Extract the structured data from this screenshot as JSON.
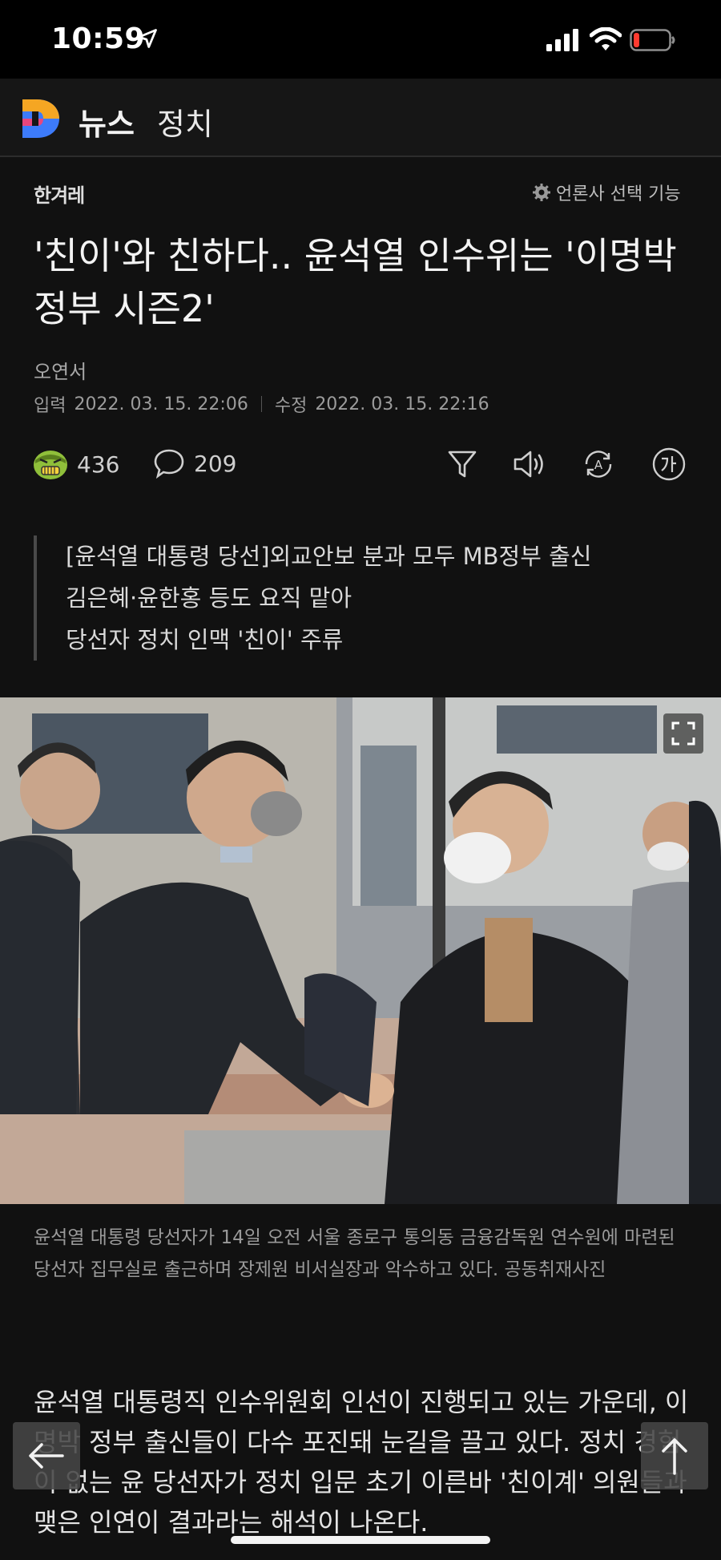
{
  "status_bar": {
    "time": "10:59"
  },
  "header": {
    "news": "뉴스",
    "section": "정치"
  },
  "article": {
    "press": "한겨레",
    "press_select": "언론사 선택 기능",
    "title": "'친이'와 친하다.. 윤석열 인수위는 '이명박정부 시즌2'",
    "author": "오연서",
    "input_label": "입력",
    "input_date": "2022. 03. 15. 22:06",
    "edit_label": "수정",
    "edit_date": "2022. 03. 15. 22:16",
    "reaction_count": "436",
    "comment_count": "209",
    "summary": [
      "[윤석열 대통령 당선]외교안보 분과 모두 MB정부 출신",
      "김은혜·윤한홍 등도 요직 맡아",
      "당선자 정치 인맥 '친이' 주류"
    ],
    "caption": "윤석열 대통령 당선자가 14일 오전 서울 종로구 통의동 금융감독원 연수원에 마련된 당선자 집무실로 출근하며 장제원 비서실장과 악수하고 있다. 공동취재사진",
    "body": "윤석열 대통령직 인수위원회 인선이 진행되고 있는 가운데, 이명박 정부 출신들이 다수 포진돼 눈길을 끌고 있다. 정치 경험이 없는 윤 당선자가 정치 입문 초기 이른바 '친이계' 의원들과 맺은 인연이 결과라는 해석이 나온다."
  },
  "icons": {
    "status": [
      "location-arrow-icon",
      "signal-icon",
      "wifi-icon",
      "battery-low-icon"
    ],
    "toolbar": [
      "filter-icon",
      "speaker-icon",
      "translate-icon",
      "font-size-icon"
    ],
    "nav": [
      "back-arrow-icon",
      "scroll-top-icon",
      "expand-icon"
    ]
  },
  "colors": {
    "background": "#111111",
    "battery_low": "#ff3b30",
    "logo_orange": "#f5a623",
    "logo_blue": "#3d7bfa"
  }
}
